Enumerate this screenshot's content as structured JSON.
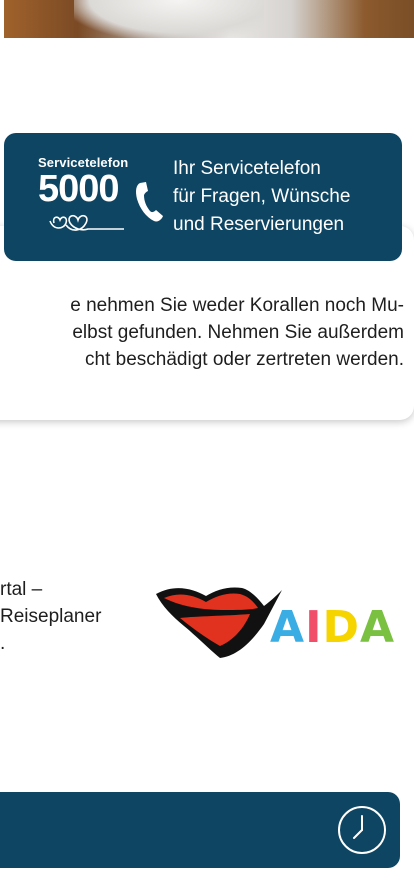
{
  "service": {
    "logo_label": "Servicetelefon",
    "logo_number": "5000",
    "lines": [
      "Ihr Servicetelefon",
      "für Fragen, Wünsche",
      "und Reservierungen"
    ]
  },
  "info": {
    "lines": [
      "e nehmen Sie weder Korallen noch Mu-",
      "elbst gefunden. Nehmen Sie außerdem",
      "cht beschädigt oder zertreten werden."
    ]
  },
  "portal": {
    "lines": [
      "rtal –",
      "Reiseplaner",
      "."
    ]
  },
  "brand": {
    "letters": [
      "A",
      "I",
      "D",
      "A"
    ],
    "colors": {
      "A1": "#3aaee4",
      "I": "#f04e69",
      "D": "#f6d400",
      "A2": "#7ac142"
    }
  },
  "colors": {
    "primary_dark_blue": "#0d4563"
  },
  "icons": {
    "phone": "phone-icon",
    "hearts": "hearts-icon",
    "clock": "clock-icon",
    "lips": "lips-icon"
  }
}
